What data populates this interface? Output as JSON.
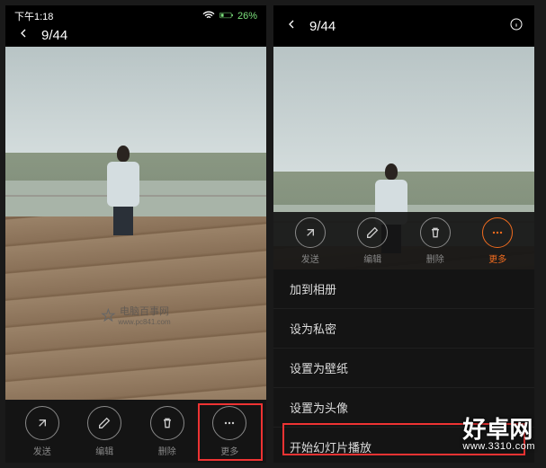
{
  "status": {
    "time": "下午1:18",
    "battery_pct": "26%"
  },
  "gallery": {
    "counter": "9/44"
  },
  "toolbar": {
    "send": "发送",
    "edit": "编辑",
    "delete": "删除",
    "more": "更多"
  },
  "options": {
    "add_to_album": "加到相册",
    "set_private": "设为私密",
    "set_wallpaper": "设置为壁纸",
    "set_avatar": "设置为头像",
    "start_slideshow": "开始幻灯片播放"
  },
  "watermark": {
    "left_text": "电脑百事网",
    "left_url": "www.pc841.com",
    "right_text": "好卓网",
    "right_url": "www.3310.com"
  }
}
